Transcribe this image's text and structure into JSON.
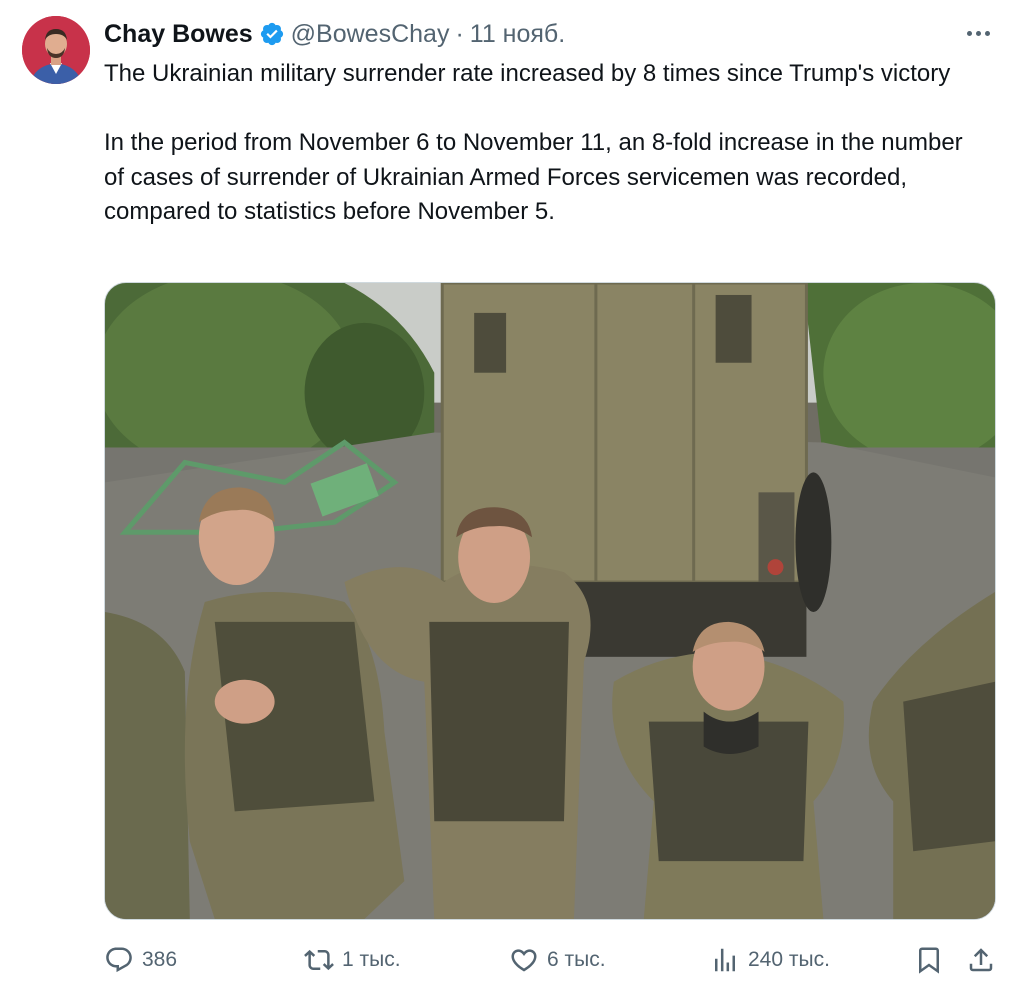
{
  "tweet": {
    "author": {
      "name": "Chay Bowes",
      "handle": "@BowesChay",
      "verified": true,
      "avatar_icon": "author-avatar"
    },
    "separator": "·",
    "timestamp": "11 нояб.",
    "text_paragraphs": [
      "The Ukrainian military surrender rate increased by 8 times since Trump's victory",
      "In the period from November 6 to November 11, an 8-fold increase in the number of cases of surrender of Ukrainian Armed Forces servicemen was recorded, compared to statistics before November 5."
    ],
    "media": {
      "type": "photo"
    },
    "actions": {
      "replies": "386",
      "reposts": "1 тыс.",
      "likes": "6 тыс.",
      "views": "240 тыс."
    }
  },
  "colors": {
    "text": "#0f1419",
    "secondary": "#536471",
    "verified_blue": "#1d9bf0",
    "border": "#cfd9de"
  }
}
